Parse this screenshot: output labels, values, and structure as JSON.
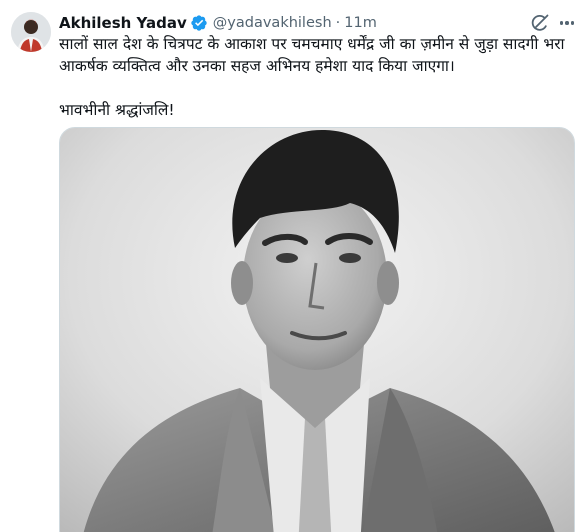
{
  "tweet": {
    "author_name": "Akhilesh Yadav",
    "handle": "@yadavakhilesh",
    "separator": "·",
    "time": "11m",
    "text_line1": "सालों साल देश के चित्रपट के आकाश पर चमचमाए धर्मेंद्र जी का ज़मीन से जुड़ा सादगी भरा",
    "text_line2": "आकर्षक व्यक्तित्व और उनका सहज अभिनय हमेशा याद किया जाएगा।",
    "text_line3": "भावभीनी श्रद्धांजलि!"
  },
  "icons": {
    "verified": "verified-badge-icon",
    "grok": "grok-icon",
    "more": "more-icon"
  },
  "colors": {
    "verified_blue": "#1d9bf0",
    "secondary_text": "#536471",
    "primary_text": "#0f1419"
  }
}
